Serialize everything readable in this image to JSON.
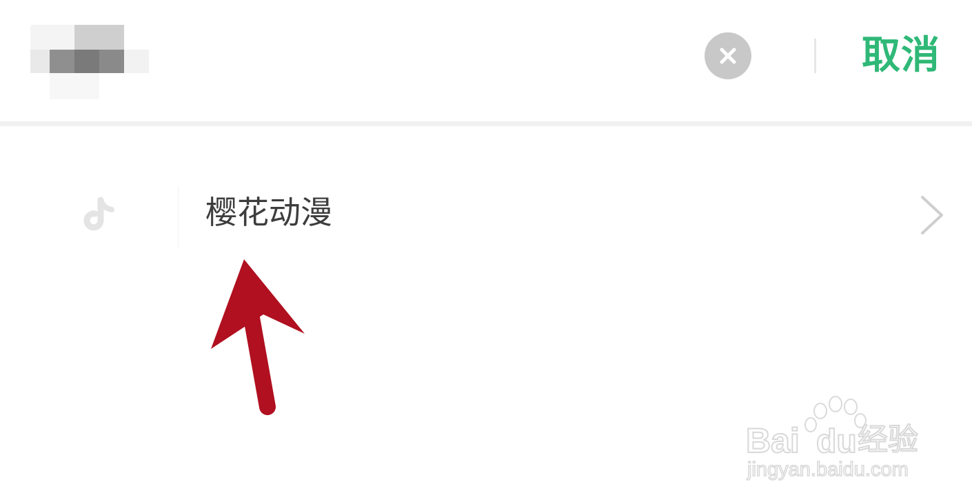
{
  "search": {
    "query_pixelated": true,
    "cancel_label": "取消"
  },
  "suggestion": {
    "text": "樱花动漫",
    "icon": "tiktok-icon"
  },
  "icons": {
    "clear": "clear-circle-x-icon",
    "chevron": "chevron-right-icon"
  },
  "colors": {
    "accent": "#2fb877",
    "arrow": "#b01020",
    "clear_bg": "#c8c8c8",
    "text": "#3d3d3d"
  },
  "watermark": {
    "line1": "Bai",
    "line1b": "du",
    "brand": "经验",
    "url": "jingyan.baidu.com"
  }
}
